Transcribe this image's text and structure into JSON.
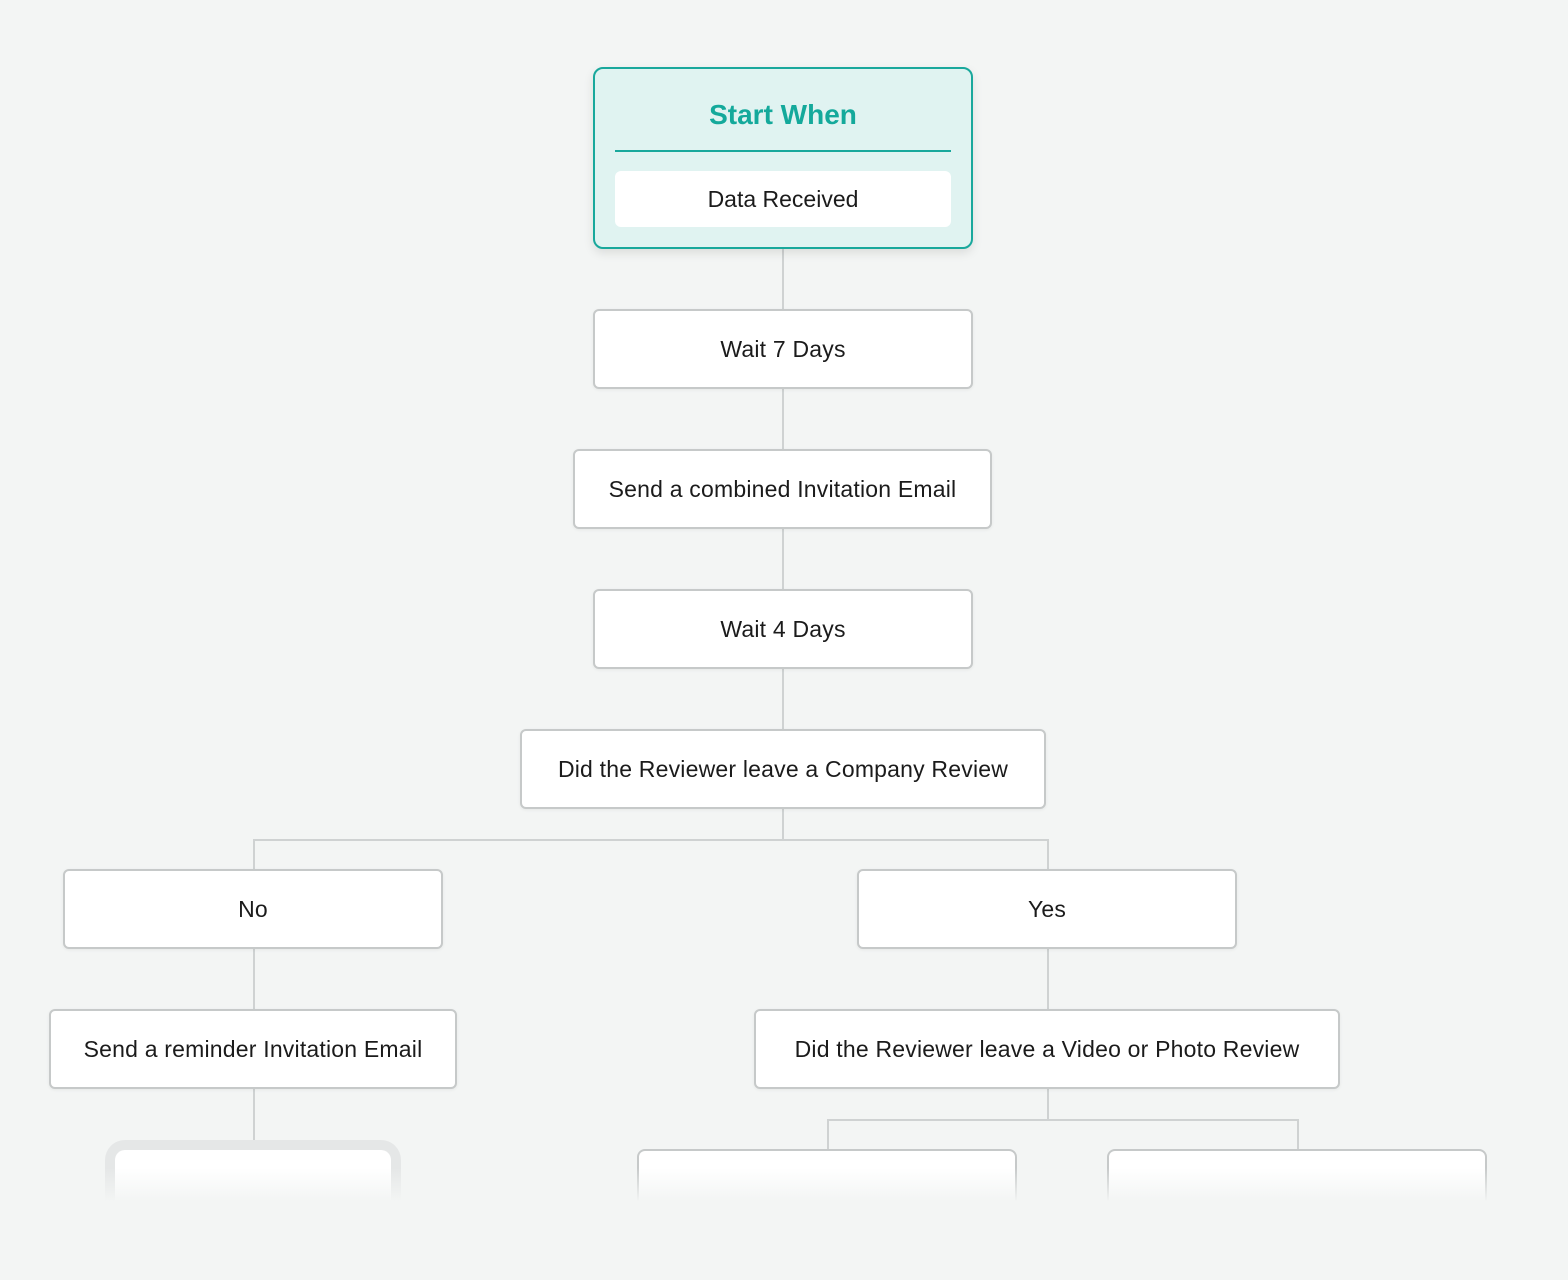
{
  "workflow": {
    "start": {
      "title": "Start When",
      "trigger": "Data Received"
    },
    "steps": [
      {
        "id": "wait-7",
        "label": "Wait 7 Days",
        "type": "wait"
      },
      {
        "id": "send-combined",
        "label": "Send a combined Invitation Email",
        "type": "action"
      },
      {
        "id": "wait-4",
        "label": "Wait 4 Days",
        "type": "wait"
      },
      {
        "id": "check-company-review",
        "label": "Did the Reviewer leave a Company Review",
        "type": "condition"
      }
    ],
    "branches": {
      "no": {
        "label": "No",
        "steps": [
          {
            "id": "send-reminder",
            "label": "Send a reminder Invitation Email",
            "type": "action"
          }
        ]
      },
      "yes": {
        "label": "Yes",
        "steps": [
          {
            "id": "check-video-photo",
            "label": "Did the Reviewer leave a Video or Photo Review",
            "type": "condition"
          }
        ]
      }
    }
  },
  "colors": {
    "accent": "#14a99b",
    "start_bg": "#e0f3f1",
    "canvas_bg": "#f3f5f4",
    "node_border": "#c6c9c9",
    "connector": "#cfd2d2"
  }
}
